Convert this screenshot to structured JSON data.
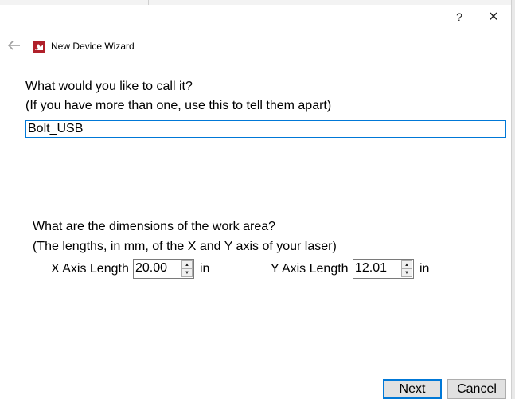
{
  "titlebar": {
    "help_label": "?",
    "close_label": "✕"
  },
  "wizard": {
    "title": "New Device Wizard",
    "back_icon": "back-arrow-icon",
    "logo_icon": "app-logo-icon",
    "logo_color": "#b0202a"
  },
  "name_section": {
    "question": "What would you like to call it?",
    "hint": "(If you have more than one, use this to tell them apart)",
    "value": "Bolt_USB"
  },
  "dimensions_section": {
    "question": "What are the dimensions of the work area?",
    "hint": "(The lengths, in mm, of the X and Y axis of your laser)",
    "x_label": "X Axis Length",
    "x_value": "20.00",
    "x_unit": "in",
    "y_label": "Y Axis Length",
    "y_value": "12.01",
    "y_unit": "in"
  },
  "footer": {
    "next_label": "Next",
    "cancel_label": "Cancel"
  },
  "colors": {
    "accent": "#0078d7",
    "button_bg": "#e1e1e1"
  }
}
